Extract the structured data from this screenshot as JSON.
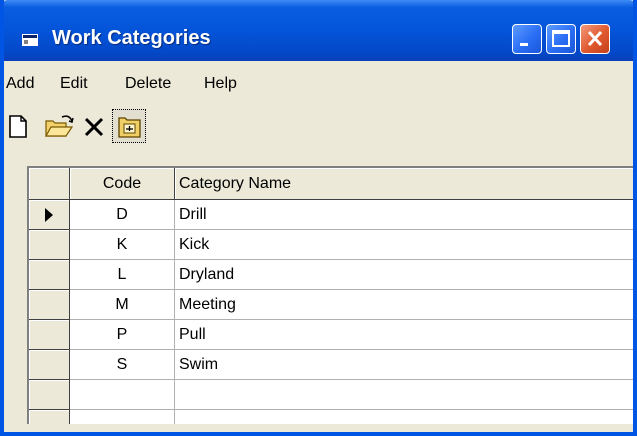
{
  "window": {
    "title": "Work Categories",
    "title_color": "#ffffff",
    "titlebar_color": "#0454d9"
  },
  "menu": {
    "items": [
      "Add",
      "Edit",
      "Delete",
      "Help"
    ]
  },
  "toolbar": {
    "tools": [
      {
        "icon": "new-document-icon"
      },
      {
        "icon": "open-folder-icon"
      },
      {
        "icon": "delete-x-icon"
      },
      {
        "icon": "filter-folder-icon",
        "pressed": true
      }
    ]
  },
  "grid": {
    "columns": [
      "Code",
      "Category Name"
    ],
    "current_row_indicator": "▶",
    "rows": [
      {
        "code": "D",
        "name": "Drill"
      },
      {
        "code": "K",
        "name": "Kick"
      },
      {
        "code": "L",
        "name": "Dryland"
      },
      {
        "code": "M",
        "name": "Meeting"
      },
      {
        "code": "P",
        "name": "Pull"
      },
      {
        "code": "S",
        "name": "Swim"
      },
      {
        "code": "",
        "name": ""
      }
    ]
  }
}
